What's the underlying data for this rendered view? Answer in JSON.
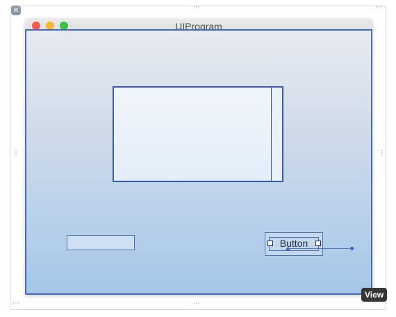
{
  "window": {
    "title": "UIProgram"
  },
  "canvas_controls": {
    "close_badge_glyph": "✕",
    "resize_handle_glyph": "⋯",
    "vertical_handle_glyph": "⋮"
  },
  "button": {
    "label": "Button"
  },
  "tooltip": {
    "text": "View"
  },
  "colors": {
    "selection_blue": "#3d59a8",
    "traffic_red": "#ee5b53",
    "traffic_yellow": "#f1b93c",
    "traffic_green": "#38c249"
  }
}
